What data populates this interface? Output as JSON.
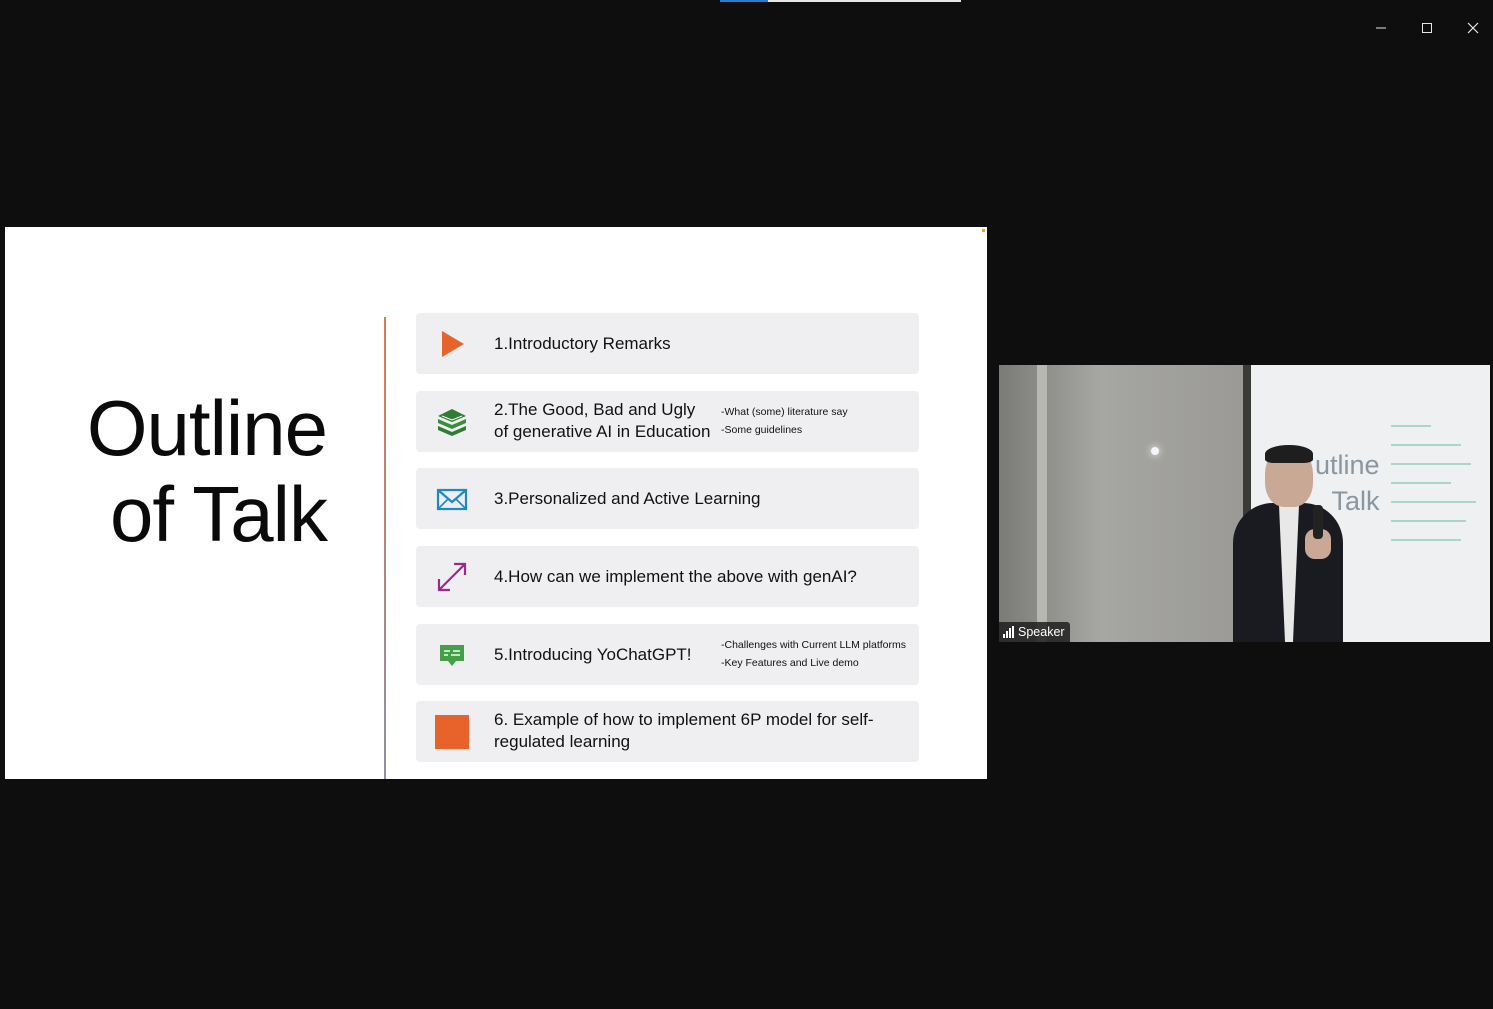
{
  "window": {
    "controls": [
      {
        "name": "minimize",
        "icon": "minimize-icon"
      },
      {
        "name": "maximize",
        "icon": "maximize-icon"
      },
      {
        "name": "close",
        "icon": "close-icon"
      }
    ]
  },
  "slide": {
    "title_line1": "Outline",
    "title_line2": "of Talk",
    "items": [
      {
        "label": "1.Introductory Remarks",
        "icon": "play-icon",
        "icon_color": "#e8622c"
      },
      {
        "label": "2.The Good, Bad and Ugly of generative AI in Education",
        "line1": "2.The Good, Bad and Ugly",
        "line2": "of generative AI in Education",
        "notes": [
          "-What (some) literature say",
          "-Some guidelines"
        ],
        "icon": "books-icon",
        "icon_color": "#2e7d32"
      },
      {
        "label": "3.Personalized and Active Learning",
        "icon": "envelope-icon",
        "icon_color": "#1e88c8"
      },
      {
        "label": "4.How can we implement the above with genAI?",
        "icon": "diagonal-arrows-icon",
        "icon_color": "#9c2a8a"
      },
      {
        "label": "5.Introducing YoChatGPT!",
        "notes": [
          "-Challenges with Current LLM platforms",
          "-Key Features and Live demo"
        ],
        "icon": "chat-icon",
        "icon_color": "#43a047"
      },
      {
        "label": "6. Example of how to implement 6P model for self-regulated learning",
        "icon": "square-icon",
        "icon_color": "#e8622c"
      }
    ]
  },
  "camera": {
    "speaker_label": "Speaker",
    "screen_text_line1": "utline",
    "screen_text_line2": "Talk"
  }
}
